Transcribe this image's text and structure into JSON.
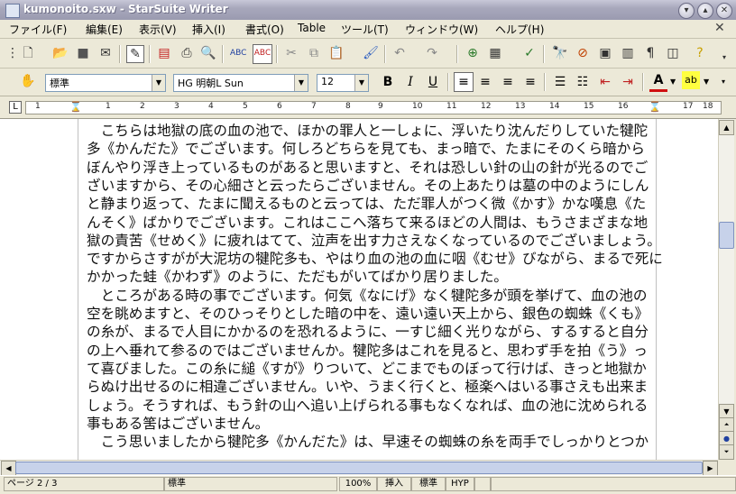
{
  "window": {
    "title": "kumonoito.sxw - StarSuite Writer"
  },
  "menu": [
    "ファイル(F)",
    "編集(E)",
    "表示(V)",
    "挿入(I)",
    "書式(O)",
    "Table",
    "ツール(T)",
    "ウィンドウ(W)",
    "ヘルプ(H)"
  ],
  "format": {
    "style": "標準",
    "font": "HG 明朝L Sun",
    "size": "12",
    "bold": "B",
    "italic": "I",
    "underline": "U"
  },
  "ruler": {
    "numbers": [
      "1",
      "1",
      "2",
      "3",
      "4",
      "5",
      "6",
      "7",
      "8",
      "9",
      "10",
      "11",
      "12",
      "13",
      "14",
      "15",
      "16",
      "17",
      "18"
    ]
  },
  "document": {
    "lines": [
      "　こちらは地獄の底の血の池で、ほかの罪人と一しょに、浮いたり沈んだりしていた犍陀",
      "多《かんだた》でございます。何しろどちらを見ても、まっ暗で、たまにそのくら暗から",
      "ぼんやり浮き上っているものがあると思いますと、それは恐しい針の山の針が光るのでご",
      "ざいますから、その心細さと云ったらございません。その上あたりは墓の中のようにしん",
      "と静まり返って、たまに聞えるものと云っては、ただ罪人がつく微《かす》かな嘆息《た",
      "んそく》ばかりでございます。これはここへ落ちて来るほどの人間は、もうさまざまな地",
      "獄の責苦《せめく》に疲れはてて、泣声を出す力さえなくなっているのでございましょう。",
      "ですからさすがが大泥坊の犍陀多も、やはり血の池の血に咽《むせ》びながら、まるで死に",
      "かかった蛙《かわず》のように、ただもがいてばかり居りました。",
      "　ところがある時の事でございます。何気《なにげ》なく犍陀多が頭を挙げて、血の池の",
      "空を眺めますと、そのひっそりとした暗の中を、遠い遠い天上から、銀色の蜘蛛《くも》",
      "の糸が、まるで人目にかかるのを恐れるように、一すじ細く光りながら、するすると自分",
      "の上へ垂れて参るのではございませんか。犍陀多はこれを見ると、思わず手を拍《う》っ",
      "て喜びました。この糸に縋《すが》りついて、どこまでものぼって行けば、きっと地獄か",
      "らぬけ出せるのに相違ございません。いや、うまく行くと、極楽へはいる事さえも出来ま",
      "しょう。そうすれば、もう針の山へ追い上げられる事もなくなれば、血の池に沈められる",
      "事もある筈はございません。",
      "　こう思いましたから犍陀多《かんだた》は、早速その蜘蛛の糸を両手でしっかりとつか"
    ]
  },
  "status": {
    "page": "ページ 2 / 3",
    "style": "標準",
    "zoom": "100%",
    "insert": "挿入",
    "select": "標準",
    "hyp": "HYP"
  }
}
